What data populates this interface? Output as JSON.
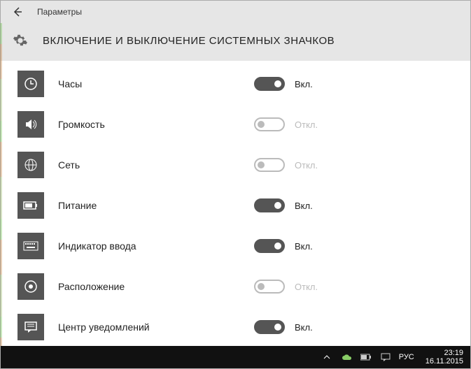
{
  "window": {
    "title": "Параметры"
  },
  "page": {
    "heading": "ВКЛЮЧЕНИЕ И ВЫКЛЮЧЕНИЕ СИСТЕМНЫХ ЗНАЧКОВ"
  },
  "toggles": {
    "on_label": "Вкл.",
    "off_label": "Откл."
  },
  "items": [
    {
      "icon": "clock-icon",
      "label": "Часы",
      "state": "on"
    },
    {
      "icon": "volume-icon",
      "label": "Громкость",
      "state": "off"
    },
    {
      "icon": "globe-icon",
      "label": "Сеть",
      "state": "off"
    },
    {
      "icon": "battery-icon",
      "label": "Питание",
      "state": "on"
    },
    {
      "icon": "keyboard-icon",
      "label": "Индикатор ввода",
      "state": "on"
    },
    {
      "icon": "location-icon",
      "label": "Расположение",
      "state": "off"
    },
    {
      "icon": "actioncenter-icon",
      "label": "Центр уведомлений",
      "state": "on"
    }
  ],
  "taskbar": {
    "lang": "РУС",
    "time": "23:19",
    "date": "16.11.2015"
  }
}
